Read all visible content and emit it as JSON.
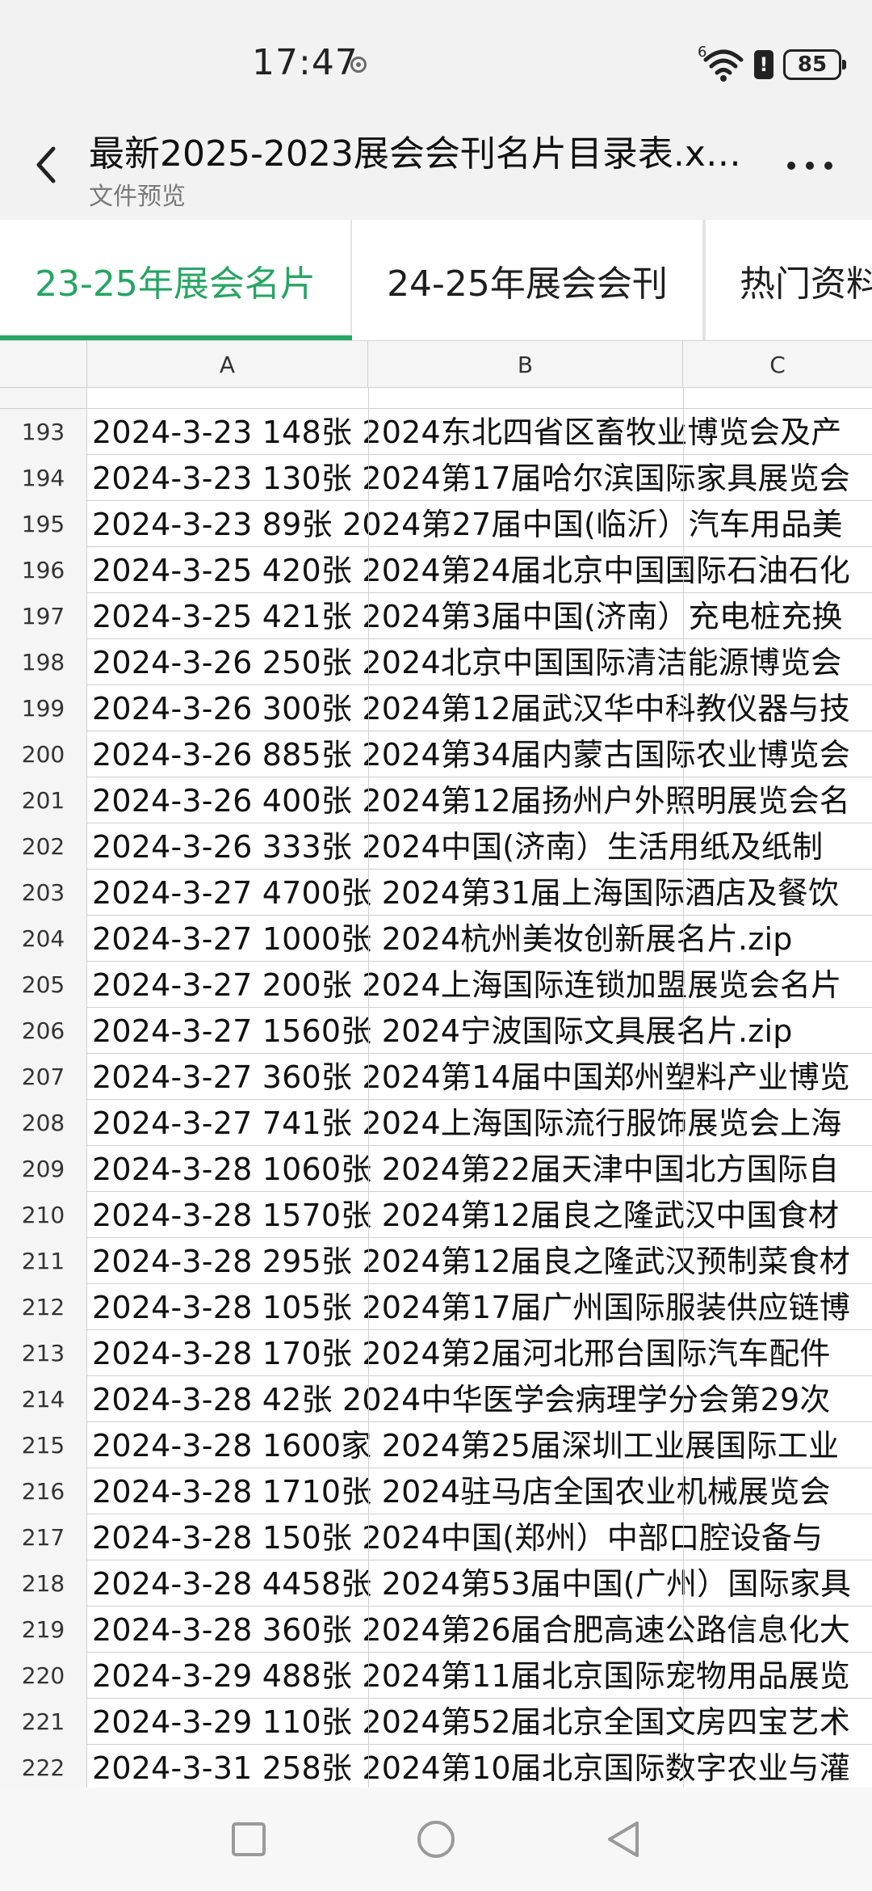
{
  "status_bar": {
    "time": "17:47",
    "signal_superscript": "6",
    "battery_level": "85",
    "battery_alert": "!"
  },
  "header": {
    "title": "最新2025-2023展会会刊名片目录表.x…",
    "subtitle": "文件预览"
  },
  "tabs": [
    {
      "label": "23-25年展会名片",
      "active": true
    },
    {
      "label": "24-25年展会会刊",
      "active": false
    },
    {
      "label": "热门资料",
      "active": false
    }
  ],
  "sheet": {
    "columns": [
      "A",
      "B",
      "C"
    ],
    "rows": [
      {
        "num": "193",
        "text": "2024-3-23 148张 2024东北四省区畜牧业博览会及产"
      },
      {
        "num": "194",
        "text": "2024-3-23 130张 2024第17届哈尔滨国际家具展览会"
      },
      {
        "num": "195",
        "text": "2024-3-23 89张 2024第27届中国(临沂）汽车用品美"
      },
      {
        "num": "196",
        "text": "2024-3-25 420张 2024第24届北京中国国际石油石化"
      },
      {
        "num": "197",
        "text": "2024-3-25 421张 2024第3届中国(济南）充电桩充换"
      },
      {
        "num": "198",
        "text": "2024-3-26 250张 2024北京中国国际清洁能源博览会"
      },
      {
        "num": "199",
        "text": "2024-3-26 300张 2024第12届武汉华中科教仪器与技"
      },
      {
        "num": "200",
        "text": "2024-3-26 885张 2024第34届内蒙古国际农业博览会"
      },
      {
        "num": "201",
        "text": "2024-3-26 400张 2024第12届扬州户外照明展览会名"
      },
      {
        "num": "202",
        "text": "2024-3-26 333张 2024中国(济南）生活用纸及纸制"
      },
      {
        "num": "203",
        "text": "2024-3-27 4700张 2024第31届上海国际酒店及餐饮"
      },
      {
        "num": "204",
        "text": "2024-3-27 1000张 2024杭州美妆创新展名片.zip"
      },
      {
        "num": "205",
        "text": "2024-3-27 200张 2024上海国际连锁加盟展览会名片"
      },
      {
        "num": "206",
        "text": "2024-3-27 1560张 2024宁波国际文具展名片.zip"
      },
      {
        "num": "207",
        "text": "2024-3-27 360张 2024第14届中国郑州塑料产业博览"
      },
      {
        "num": "208",
        "text": "2024-3-27 741张 2024上海国际流行服饰展览会上海"
      },
      {
        "num": "209",
        "text": "2024-3-28 1060张 2024第22届天津中国北方国际自"
      },
      {
        "num": "210",
        "text": "2024-3-28 1570张 2024第12届良之隆武汉中国食材"
      },
      {
        "num": "211",
        "text": "2024-3-28 295张 2024第12届良之隆武汉预制菜食材"
      },
      {
        "num": "212",
        "text": "2024-3-28 105张 2024第17届广州国际服装供应链博"
      },
      {
        "num": "213",
        "text": "2024-3-28 170张 2024第2届河北邢台国际汽车配件"
      },
      {
        "num": "214",
        "text": "2024-3-28 42张 2024中华医学会病理学分会第29次"
      },
      {
        "num": "215",
        "text": "2024-3-28 1600家 2024第25届深圳工业展国际工业"
      },
      {
        "num": "216",
        "text": "2024-3-28 1710张 2024驻马店全国农业机械展览会"
      },
      {
        "num": "217",
        "text": "2024-3-28 150张 2024中国(郑州）中部口腔设备与"
      },
      {
        "num": "218",
        "text": "2024-3-28 4458张 2024第53届中国(广州）国际家具"
      },
      {
        "num": "219",
        "text": "2024-3-28 360张 2024第26届合肥高速公路信息化大"
      },
      {
        "num": "220",
        "text": "2024-3-29 488张 2024第11届北京国际宠物用品展览"
      },
      {
        "num": "221",
        "text": "2024-3-29 110张 2024第52届北京全国文房四宝艺术"
      },
      {
        "num": "222",
        "text": "2024-3-31 258张 2024第10届北京国际数字农业与灌"
      }
    ]
  },
  "colors": {
    "accent": "#26a563",
    "header_bg": "#f2f2f2",
    "grid_line": "#cfcfcf"
  },
  "icons": {
    "back": "chevron-left-icon",
    "more": "more-dots-icon",
    "nav": [
      "recents-square-icon",
      "home-circle-icon",
      "back-triangle-icon"
    ]
  }
}
